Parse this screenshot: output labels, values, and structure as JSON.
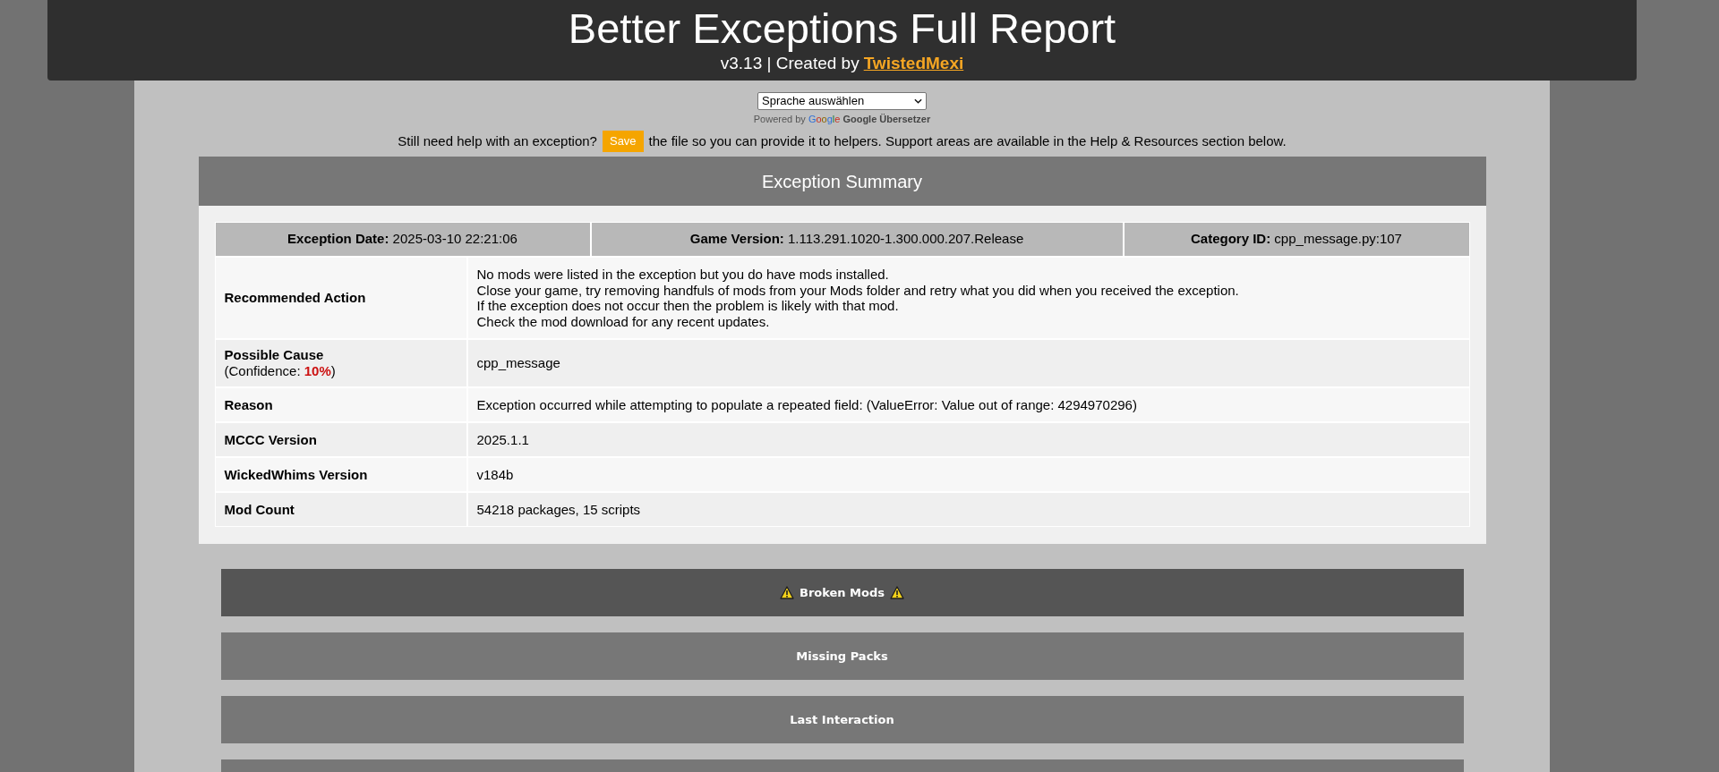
{
  "header": {
    "title": "Better Exceptions Full Report",
    "subtitle": "v3.13 | Created by",
    "author_link": "TwistedMexi"
  },
  "translate": {
    "select": "Sprache auswählen",
    "powered_by": "Powered by",
    "logo": "Google",
    "service_link": "Google Übersetzer"
  },
  "help": {
    "before": "Still need help with an exception?",
    "button": "Save",
    "after": "the file so you can provide it to helpers. Support areas are available in the Help & Resources section below."
  },
  "summary": {
    "title": "Exception Summary",
    "header_cells": [
      "**Exception Date:** 2025-03-10 22:21:06",
      "**Game Version:** 1.113.291.1020-1.300.000.207.Release",
      "**Category ID:** cpp_message.py:107"
    ],
    "rows": [
      {
        "label": "Recommended Action",
        "lines": [
          "No mods were listed in the exception but you do have mods installed.",
          "Close your game, try removing handfuls of mods from your Mods folder and retry what you did when you received the exception.",
          "If the exception does not occur then the problem is likely with that mod.",
          "Check the mod download for any recent updates."
        ]
      },
      {
        "label": "Possible Cause",
        "note": "(Confidence: **10%**)",
        "lines": [
          "cpp_message"
        ]
      },
      {
        "label": "Reason",
        "lines": [
          "Exception occurred while attempting to populate a repeated field: (ValueError: Value out of range: 4294970296)"
        ]
      },
      {
        "label": "MCCC Version",
        "lines": [
          "2025.1.1"
        ]
      },
      {
        "label": "WickedWhims Version",
        "lines": [
          "v184b"
        ]
      },
      {
        "label": "Mod Count",
        "lines": [
          "54218 packages, 15 scripts"
        ]
      }
    ]
  },
  "sections": [
    {
      "label": "Broken Mods",
      "warning": true
    },
    {
      "label": "Missing Packs",
      "warning": false
    },
    {
      "label": "Last Interaction",
      "warning": false
    },
    {
      "warning": false
    }
  ]
}
